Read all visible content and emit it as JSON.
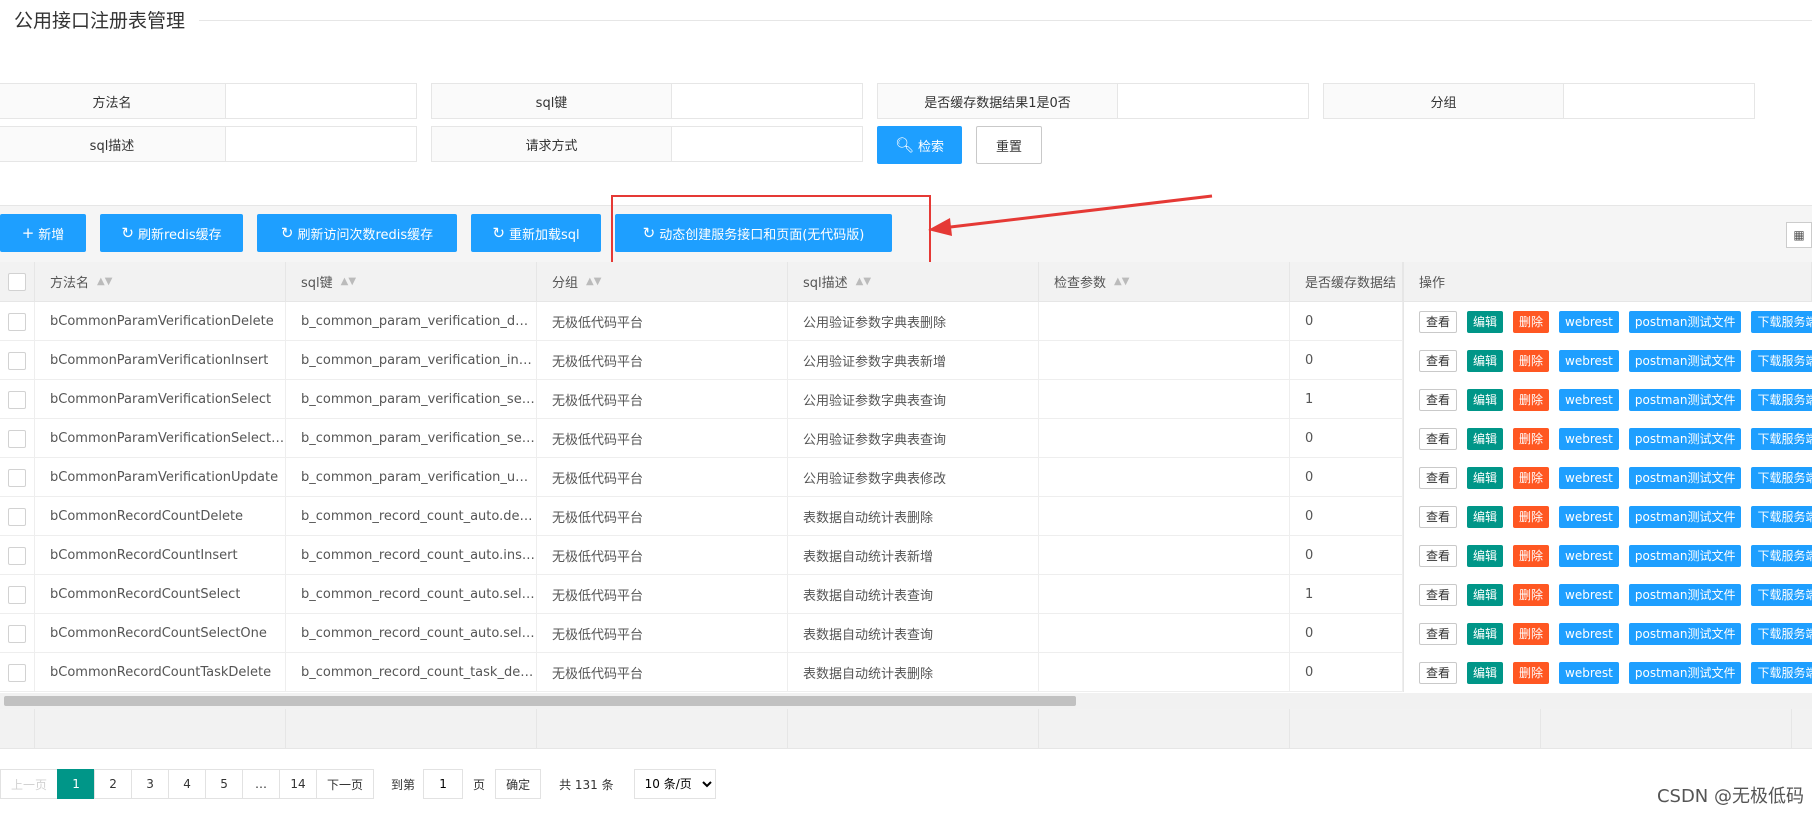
{
  "page_title": "公用接口注册表管理",
  "search": {
    "fields": [
      {
        "label": "方法名",
        "value": ""
      },
      {
        "label": "sql键",
        "value": ""
      },
      {
        "label": "是否缓存数据结果1是0否",
        "value": ""
      },
      {
        "label": "分组",
        "value": ""
      },
      {
        "label": "sql描述",
        "value": ""
      },
      {
        "label": "请求方式",
        "value": ""
      }
    ],
    "search_button": "检索",
    "reset_button": "重置"
  },
  "toolbar": {
    "add": "新增",
    "refresh_redis": "刷新redis缓存",
    "refresh_visit_redis": "刷新访问次数redis缓存",
    "reload_sql": "重新加载sql",
    "dynamic_create": "动态创建服务接口和页面(无代码版)"
  },
  "table": {
    "headers": [
      "方法名",
      "sql键",
      "分组",
      "sql描述",
      "检查参数",
      "是否缓存数据结",
      "操作"
    ],
    "rows": [
      {
        "method": "bCommonParamVerificationDelete",
        "sqlkey": "b_common_param_verification_delete",
        "group": "无极低代码平台",
        "desc": "公用验证参数字典表删除",
        "check": "",
        "cache": "0"
      },
      {
        "method": "bCommonParamVerificationInsert",
        "sqlkey": "b_common_param_verification_insert",
        "group": "无极低代码平台",
        "desc": "公用验证参数字典表新增",
        "check": "",
        "cache": "0"
      },
      {
        "method": "bCommonParamVerificationSelect",
        "sqlkey": "b_common_param_verification_select",
        "group": "无极低代码平台",
        "desc": "公用验证参数字典表查询",
        "check": "",
        "cache": "1"
      },
      {
        "method": "bCommonParamVerificationSelectOne",
        "sqlkey": "b_common_param_verification_selectone",
        "group": "无极低代码平台",
        "desc": "公用验证参数字典表查询",
        "check": "",
        "cache": "0"
      },
      {
        "method": "bCommonParamVerificationUpdate",
        "sqlkey": "b_common_param_verification_update",
        "group": "无极低代码平台",
        "desc": "公用验证参数字典表修改",
        "check": "",
        "cache": "0"
      },
      {
        "method": "bCommonRecordCountDelete",
        "sqlkey": "b_common_record_count_auto.delete",
        "group": "无极低代码平台",
        "desc": "表数据自动统计表删除",
        "check": "",
        "cache": "0"
      },
      {
        "method": "bCommonRecordCountInsert",
        "sqlkey": "b_common_record_count_auto.insert",
        "group": "无极低代码平台",
        "desc": "表数据自动统计表新增",
        "check": "",
        "cache": "0"
      },
      {
        "method": "bCommonRecordCountSelect",
        "sqlkey": "b_common_record_count_auto.select",
        "group": "无极低代码平台",
        "desc": "表数据自动统计表查询",
        "check": "",
        "cache": "1"
      },
      {
        "method": "bCommonRecordCountSelectOne",
        "sqlkey": "b_common_record_count_auto.selectone",
        "group": "无极低代码平台",
        "desc": "表数据自动统计表查询",
        "check": "",
        "cache": "0"
      },
      {
        "method": "bCommonRecordCountTaskDelete",
        "sqlkey": "b_common_record_count_task_delete",
        "group": "无极低代码平台",
        "desc": "表数据自动统计表删除",
        "check": "",
        "cache": "0"
      }
    ],
    "ops": {
      "view": "查看",
      "edit": "编辑",
      "del": "删除",
      "webrest": "webrest",
      "postman": "postman测试文件",
      "download": "下载服务端"
    }
  },
  "pager": {
    "prev": "上一页",
    "pages": [
      "1",
      "2",
      "3",
      "4",
      "5",
      "…",
      "14"
    ],
    "current": "1",
    "next": "下一页",
    "goto_label": "到第",
    "goto_value": "1",
    "page_unit": "页",
    "confirm": "确定",
    "total": "共 131 条",
    "page_size": "10 条/页"
  },
  "watermark": "CSDN @无极低码",
  "colors": {
    "primary": "#1e9fff",
    "teal": "#009688",
    "danger": "#ff5722",
    "annotation": "#e53935"
  }
}
